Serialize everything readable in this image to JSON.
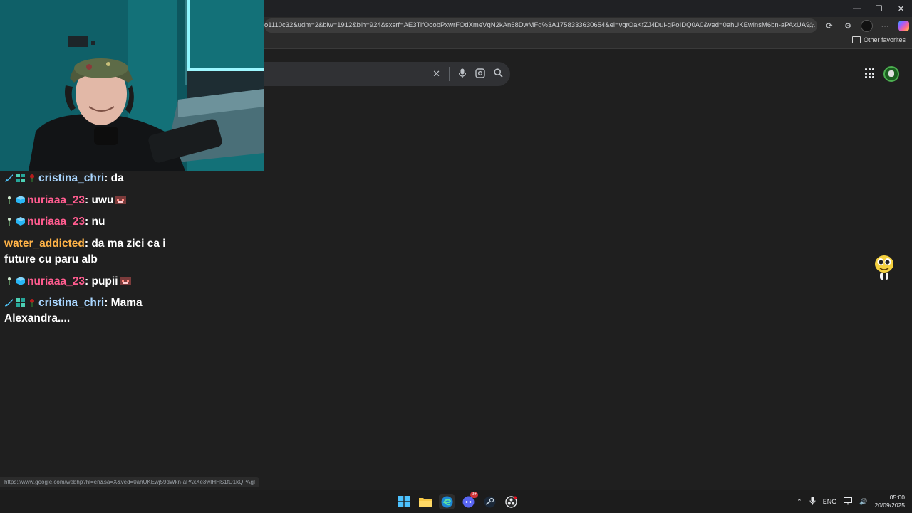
{
  "browser": {
    "address_url": "o1110c32&udm=2&biw=1912&bih=924&sxsrf=AE3TifOoobPxwrFOdXmeVqN2kAn58DwMFg%3A1758333630654&ei=vgrOaKfZJ4Dui-gPoIDQ0A0&ved=0ahUKEwinsM6bn-aPAxUA9...",
    "other_favorites_label": "Other favorites",
    "status_url": "https://www.google.com/webhp?hl=en&sa=X&ved=0ahUKEwj59dWkn-aPAxXe3wIHHS1fD1kQPAgI"
  },
  "icons": {
    "minimize": "minimize-icon",
    "restore": "restore-icon",
    "close": "close-icon",
    "star": "star-icon",
    "extensions": "extensions-icon",
    "clear": "clear-icon",
    "mic": "mic-icon",
    "lens": "lens-icon",
    "search": "search-icon",
    "apps": "apps-grid-icon"
  },
  "chat": {
    "messages": [
      {
        "user": "cristina_chri",
        "text": " da",
        "color": "#a9d6ff"
      },
      {
        "user": "nuriaaa_23",
        "text": " uwu",
        "color": "#ff5c8f"
      },
      {
        "user": "nuriaaa_23",
        "text": " nu",
        "color": "#ff5c8f"
      },
      {
        "user": "water_addicted",
        "text": " da ma zici ca i future cu paru alb",
        "color": "#ffb347"
      },
      {
        "user": "nuriaaa_23",
        "text": " pupii",
        "color": "#ff5c8f"
      },
      {
        "user": "cristina_chri",
        "text": " Mama Alexandra....",
        "color": "#a9d6ff"
      }
    ]
  },
  "taskbar": {
    "discord_badge": "9+",
    "language": "ENG",
    "time": "05:00",
    "date": "20/09/2025"
  }
}
